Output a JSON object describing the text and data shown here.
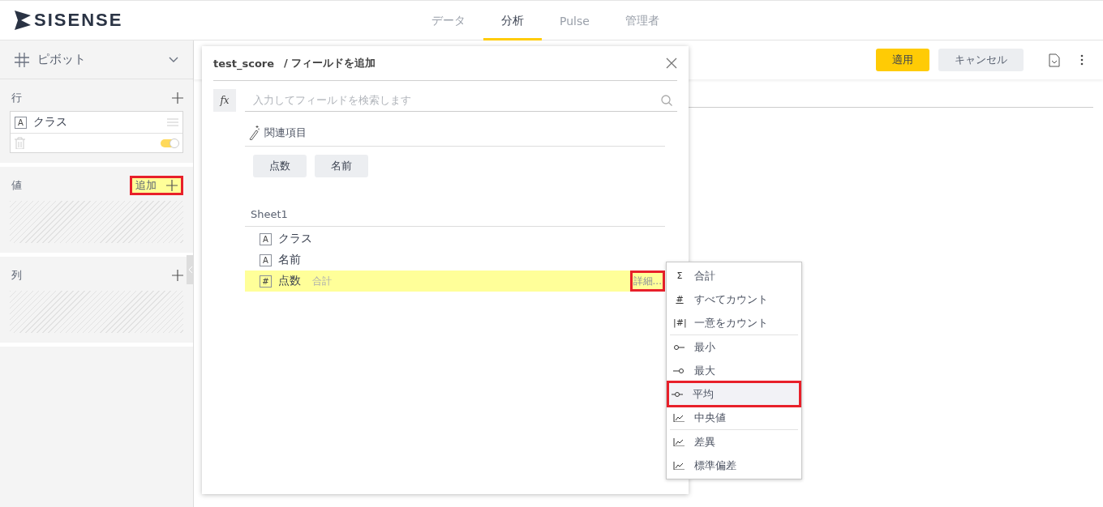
{
  "header": {
    "logo": "SISENSE"
  },
  "tabs": [
    {
      "label": "データ",
      "selected": false
    },
    {
      "label": "分析",
      "selected": true
    },
    {
      "label": "Pulse",
      "selected": false
    },
    {
      "label": "管理者",
      "selected": false
    }
  ],
  "toolbar": {
    "buttons": [
      {
        "label": "適用",
        "kind": "primary"
      },
      {
        "label": "キャンセル",
        "kind": "secondary"
      }
    ]
  },
  "sidebar": {
    "widget_type": "ピボット",
    "sections": [
      {
        "label": "行",
        "items": [
          {
            "type": "A",
            "name": "クラス",
            "on": true
          }
        ]
      },
      {
        "label": "値",
        "add_label": "追加",
        "annotated": true
      },
      {
        "label": "列"
      }
    ]
  },
  "dialog": {
    "source": "test_score",
    "title": "/ フィールドを追加",
    "fx": "fx",
    "search": {
      "placeholder": "入力してフィールドを検索します"
    },
    "related": {
      "label": "関連項目",
      "chips": [
        "点数",
        "名前"
      ]
    },
    "table": "Sheet1",
    "fields": [
      {
        "type": "A",
        "name": "クラス",
        "selected": false
      },
      {
        "type": "A",
        "name": "名前",
        "selected": false
      },
      {
        "type": "#",
        "name": "点数",
        "aggregation": "合計",
        "more": "詳細...",
        "selected": true,
        "annotated": true
      }
    ]
  },
  "menu": {
    "groups": [
      [
        {
          "icon": {
            "kind": "text",
            "text": "Σ"
          },
          "label": "合計",
          "selected": false,
          "annotated": false
        },
        {
          "icon": {
            "kind": "text",
            "text": "#"
          },
          "label": "すべてカウント",
          "selected": false,
          "annotated": false
        },
        {
          "icon": {
            "kind": "text",
            "text": "|#|"
          },
          "label": "一意をカウント",
          "selected": false,
          "annotated": false
        }
      ],
      [
        {
          "icon": {
            "kind": "min"
          },
          "label": "最小",
          "selected": false,
          "annotated": false
        },
        {
          "icon": {
            "kind": "max"
          },
          "label": "最大",
          "selected": false,
          "annotated": false
        },
        {
          "icon": {
            "kind": "avg"
          },
          "label": "平均",
          "selected": true,
          "annotated": true
        },
        {
          "icon": {
            "kind": "chart"
          },
          "label": "中央値",
          "selected": false,
          "annotated": false
        }
      ],
      [
        {
          "icon": {
            "kind": "chart"
          },
          "label": "差異",
          "selected": false,
          "annotated": false
        },
        {
          "icon": {
            "kind": "chart"
          },
          "label": "標準偏差",
          "selected": false,
          "annotated": false
        }
      ]
    ]
  }
}
